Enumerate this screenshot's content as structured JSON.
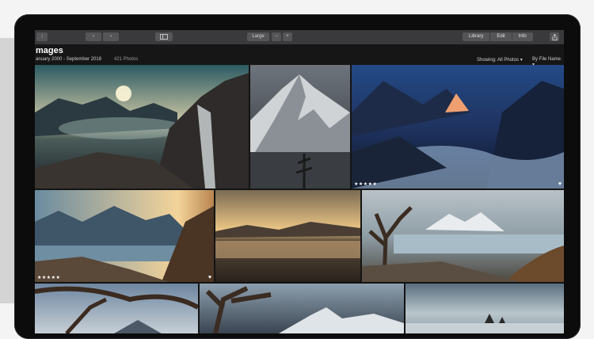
{
  "toolbar": {
    "size_label": "Large",
    "zoom_out": "−",
    "zoom_in": "+",
    "tabs": [
      "Library",
      "Edit",
      "Info"
    ],
    "btn_import": "↓",
    "btn_back": "‹",
    "btn_forward": "›"
  },
  "header": {
    "title": "mages",
    "date_range": "anuary 2000 - September 2018",
    "count": "421 Photos",
    "showing": "Showing: All Photos ▾",
    "sort": "By File Name ▾"
  },
  "photos": [
    {
      "name": "Fjord sunset waterfall",
      "rating": "",
      "favorite": ""
    },
    {
      "name": "Snowy mountain peak",
      "rating": "",
      "favorite": ""
    },
    {
      "name": "Glacial river at dusk",
      "rating": "★★★★★",
      "favorite": "♥"
    },
    {
      "name": "Coastal mountains sunburst",
      "rating": "★★★★★",
      "favorite": "♥"
    },
    {
      "name": "Golden lake reflection",
      "rating": "",
      "favorite": ""
    },
    {
      "name": "Dead tree by alpine lake",
      "rating": "",
      "favorite": ""
    },
    {
      "name": "Twisted tree branches",
      "rating": "",
      "favorite": ""
    },
    {
      "name": "Tree framing peaks",
      "rating": "",
      "favorite": ""
    },
    {
      "name": "Sea stacks twilight",
      "rating": "",
      "favorite": ""
    }
  ],
  "colors": {
    "toolbar": "#3a3a3c",
    "screen": "#141414",
    "bezel": "#0c0c0d"
  }
}
